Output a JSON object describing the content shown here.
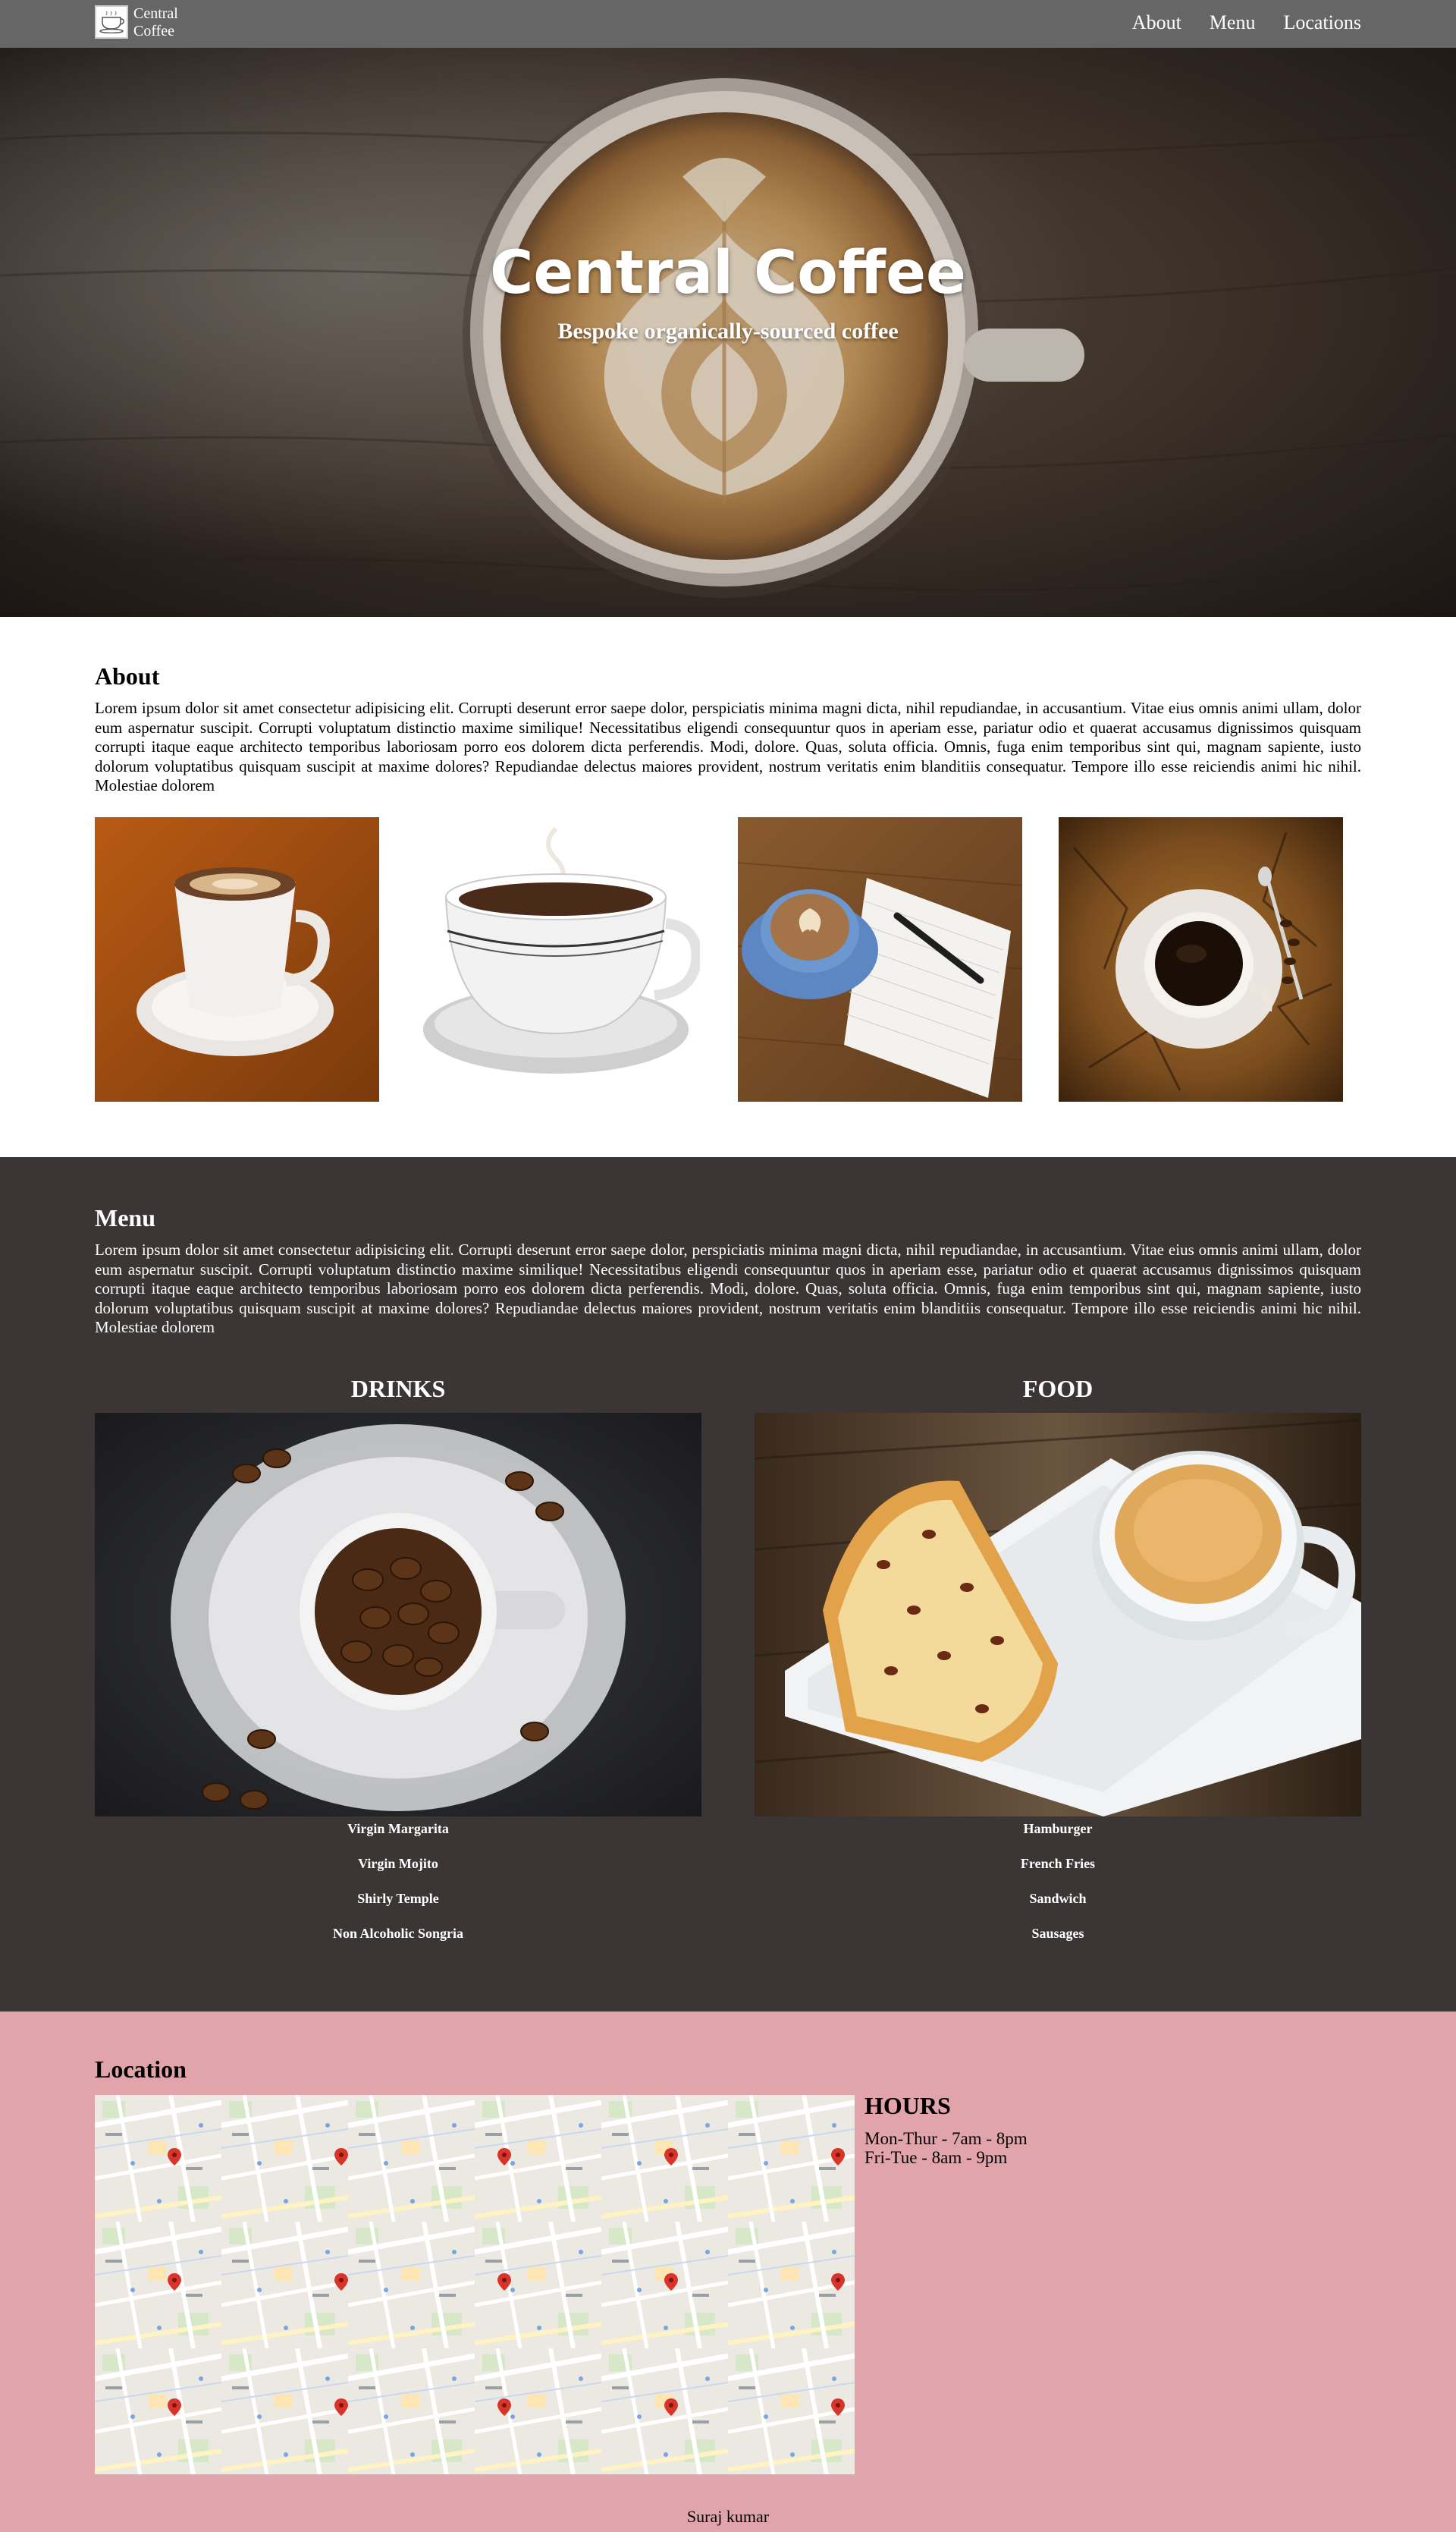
{
  "nav": {
    "brand": "Central Coffee",
    "links": [
      "About",
      "Menu",
      "Locations"
    ]
  },
  "hero": {
    "title": "Central Coffee",
    "subtitle": "Bespoke organically-sourced coffee"
  },
  "about": {
    "heading": "About",
    "body": "Lorem ipsum dolor sit amet consectetur adipisicing elit. Corrupti deserunt error saepe dolor, perspiciatis minima magni dicta, nihil repudiandae, in accusantium. Vitae eius omnis animi ullam, dolor eum aspernatur suscipit. Corrupti voluptatum distinctio maxime similique! Necessitatibus eligendi consequuntur quos in aperiam esse, pariatur odio et quaerat accusamus dignissimos quisquam corrupti itaque eaque architecto temporibus laboriosam porro eos dolorem dicta perferendis. Modi, dolore. Quas, soluta officia. Omnis, fuga enim temporibus sint qui, magnam sapiente, iusto dolorum voluptatibus quisquam suscipit at maxime dolores? Repudiandae delectus maiores provident, nostrum veritatis enim blanditiis consequatur. Tempore illo esse reiciendis animi hic nihil. Molestiae dolorem"
  },
  "menu": {
    "heading": "Menu",
    "body": "Lorem ipsum dolor sit amet consectetur adipisicing elit. Corrupti deserunt error saepe dolor, perspiciatis minima magni dicta, nihil repudiandae, in accusantium. Vitae eius omnis animi ullam, dolor eum aspernatur suscipit. Corrupti voluptatum distinctio maxime similique! Necessitatibus eligendi consequuntur quos in aperiam esse, pariatur odio et quaerat accusamus dignissimos quisquam corrupti itaque eaque architecto temporibus laboriosam porro eos dolorem dicta perferendis. Modi, dolore. Quas, soluta officia. Omnis, fuga enim temporibus sint qui, magnam sapiente, iusto dolorum voluptatibus quisquam suscipit at maxime dolores? Repudiandae delectus maiores provident, nostrum veritatis enim blanditiis consequatur. Tempore illo esse reiciendis animi hic nihil. Molestiae dolorem",
    "drinks": {
      "title": "DRINKS",
      "items": [
        "Virgin Margarita",
        "Virgin Mojito",
        "Shirly Temple",
        "Non Alcoholic Songria"
      ]
    },
    "food": {
      "title": "FOOD",
      "items": [
        "Hamburger",
        "French Fries",
        "Sandwich",
        "Sausages"
      ]
    }
  },
  "location": {
    "heading": "Location",
    "hours_title": "HOURS",
    "hours": [
      "Mon-Thur - 7am - 8pm",
      "Fri-Tue - 8am - 9pm"
    ]
  },
  "footer": {
    "credit": "Suraj kumar"
  },
  "colors": {
    "navbar": "#666666",
    "menu_bg": "#3b3635",
    "location_bg": "#e2a4ab"
  }
}
